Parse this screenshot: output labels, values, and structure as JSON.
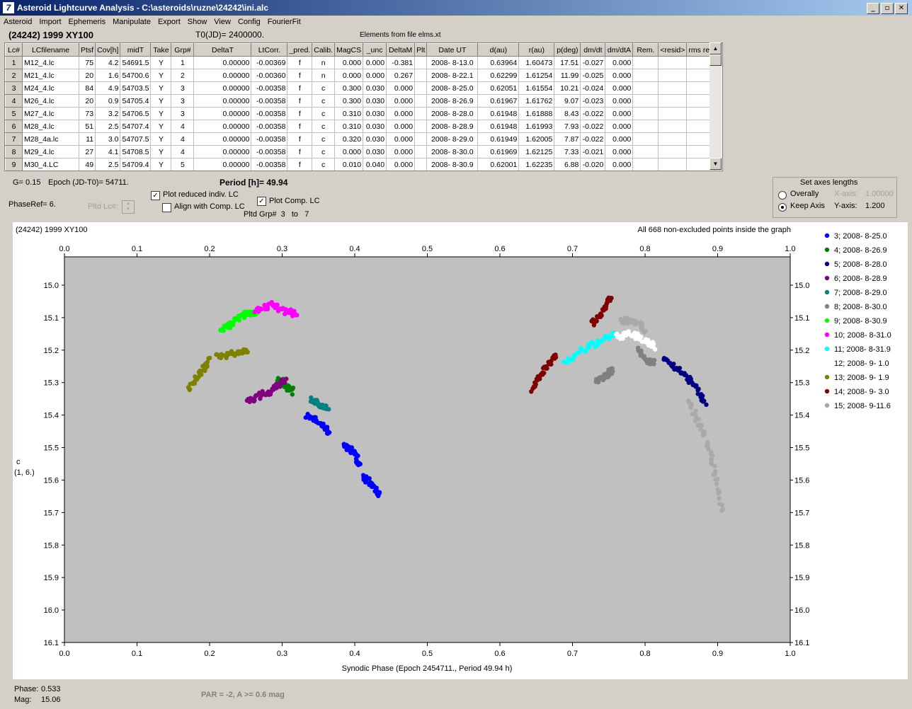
{
  "window": {
    "title": "Asteroid Lightcurve Analysis - C:\\asteroids\\ruzne\\24242\\ini.alc",
    "app_icon_glyph": "7",
    "buttons": {
      "minimize": "_",
      "restore": "▫",
      "close": "✕"
    }
  },
  "menu": [
    "Asteroid",
    "Import",
    "Ephemeris",
    "Manipulate",
    "Export",
    "Show",
    "View",
    "Config",
    "FourierFit"
  ],
  "header": {
    "target": "(24242) 1999 XY100",
    "t0": "T0(JD)= 2400000.",
    "elements": "Elements from file elms.xt"
  },
  "table": {
    "columns": [
      "Lc#",
      "LCfilename",
      "Ptsf",
      "Cov[h]",
      "midT",
      "Take",
      "Grp#",
      "DeltaT",
      "LtCorr.",
      "_pred.",
      "Calib.",
      "MagCS",
      "_unc",
      "DeltaM",
      "Plt",
      "Date UT",
      "d(au)",
      "r(au)",
      "p(deg)",
      "dm/dt",
      "dm/dtA",
      "Rem.",
      "<resid>",
      "rms res"
    ],
    "rows": [
      [
        "1",
        "M12_4.lc",
        "75",
        "4.2",
        "54691.5",
        "Y",
        "1",
        "0.00000",
        "-0.00369",
        "f",
        "n",
        "0.000",
        "0.000",
        "-0.381",
        "",
        "2008- 8-13.0",
        "0.63964",
        "1.60473",
        "17.51",
        "-0.027",
        "0.000",
        "",
        "",
        ""
      ],
      [
        "2",
        "M21_4.lc",
        "20",
        "1.6",
        "54700.6",
        "Y",
        "2",
        "0.00000",
        "-0.00360",
        "f",
        "n",
        "0.000",
        "0.000",
        "0.267",
        "",
        "2008- 8-22.1",
        "0.62299",
        "1.61254",
        "11.99",
        "-0.025",
        "0.000",
        "",
        "",
        ""
      ],
      [
        "3",
        "M24_4.lc",
        "84",
        "4.9",
        "54703.5",
        "Y",
        "3",
        "0.00000",
        "-0.00358",
        "f",
        "c",
        "0.300",
        "0.030",
        "0.000",
        "",
        "2008- 8-25.0",
        "0.62051",
        "1.61554",
        "10.21",
        "-0.024",
        "0.000",
        "",
        "",
        ""
      ],
      [
        "4",
        "M26_4.lc",
        "20",
        "0.9",
        "54705.4",
        "Y",
        "3",
        "0.00000",
        "-0.00358",
        "f",
        "c",
        "0.300",
        "0.030",
        "0.000",
        "",
        "2008- 8-26.9",
        "0.61967",
        "1.61762",
        "9.07",
        "-0.023",
        "0.000",
        "",
        "",
        ""
      ],
      [
        "5",
        "M27_4.lc",
        "73",
        "3.2",
        "54706.5",
        "Y",
        "3",
        "0.00000",
        "-0.00358",
        "f",
        "c",
        "0.310",
        "0.030",
        "0.000",
        "",
        "2008- 8-28.0",
        "0.61948",
        "1.61888",
        "8.43",
        "-0.022",
        "0.000",
        "",
        "",
        ""
      ],
      [
        "6",
        "M28_4.lc",
        "51",
        "2.5",
        "54707.4",
        "Y",
        "4",
        "0.00000",
        "-0.00358",
        "f",
        "c",
        "0.310",
        "0.030",
        "0.000",
        "",
        "2008- 8-28.9",
        "0.61948",
        "1.61993",
        "7.93",
        "-0.022",
        "0.000",
        "",
        "",
        ""
      ],
      [
        "7",
        "M28_4a.lc",
        "11",
        "3.0",
        "54707.5",
        "Y",
        "4",
        "0.00000",
        "-0.00358",
        "f",
        "c",
        "0.320",
        "0.030",
        "0.000",
        "",
        "2008- 8-29.0",
        "0.61949",
        "1.62005",
        "7.87",
        "-0.022",
        "0.000",
        "",
        "",
        ""
      ],
      [
        "8",
        "M29_4.lc",
        "27",
        "4.1",
        "54708.5",
        "Y",
        "4",
        "0.00000",
        "-0.00358",
        "f",
        "c",
        "0.000",
        "0.030",
        "0.000",
        "",
        "2008- 8-30.0",
        "0.61969",
        "1.62125",
        "7.33",
        "-0.021",
        "0.000",
        "",
        "",
        ""
      ],
      [
        "9",
        "M30_4.LC",
        "49",
        "2.5",
        "54709.4",
        "Y",
        "5",
        "0.00000",
        "-0.00358",
        "f",
        "c",
        "0.010",
        "0.040",
        "0.000",
        "",
        "2008- 8-30.9",
        "0.62001",
        "1.62235",
        "6.88",
        "-0.020",
        "0.000",
        "",
        "",
        ""
      ]
    ]
  },
  "controls": {
    "g": "G= 0.15",
    "epoch": "Epoch (JD-T0)= 54711.",
    "period": "Period [h]= 49.94",
    "phase_ref": "PhaseRef= 6.",
    "pltd_lc": "Pltd Lc#:",
    "plot_reduced": "Plot reduced indiv. LC",
    "plot_reduced_checked": true,
    "align_comp": "Align with Comp. LC",
    "align_comp_checked": false,
    "plot_comp": "Plot Comp. LC",
    "plot_comp_checked": true,
    "pltd_grp": "Pltd Grp#  3   to   7"
  },
  "axes_box": {
    "title": "Set axes lengths",
    "overally": "Overally",
    "keep_axis": "Keep Axis",
    "x_label": "X-axis:",
    "x_value": "1.00000",
    "y_label": "Y-axis:",
    "y_value": "1.200",
    "selected": "keep_axis"
  },
  "chart_data": {
    "type": "scatter",
    "title": "(24242) 1999 XY100",
    "annotation": "All 668 non-excluded points inside the graph",
    "xlabel": "Synodic Phase (Epoch 2454711., Period 49.94 h)",
    "ylabel_lines": [
      "c",
      "(1, 6.)"
    ],
    "xlim": [
      0.0,
      1.0
    ],
    "ylim": [
      16.1,
      14.9
    ],
    "y_inverted": true,
    "x_ticks": [
      "0.0",
      "0.1",
      "0.2",
      "0.3",
      "0.4",
      "0.5",
      "0.6",
      "0.7",
      "0.8",
      "0.9",
      "1.0"
    ],
    "y_ticks": [
      "15.0",
      "15.1",
      "15.2",
      "15.3",
      "15.4",
      "15.5",
      "15.6",
      "15.7",
      "15.8",
      "15.9",
      "16.0",
      "16.1"
    ],
    "legend_position": "right",
    "series": [
      {
        "name": "3; 2008- 8-25.0",
        "color": "#0000ff",
        "segments": [
          [
            [
              0.335,
              15.4
            ],
            [
              0.355,
              15.43
            ],
            [
              0.365,
              15.46
            ]
          ],
          [
            [
              0.383,
              15.49
            ],
            [
              0.397,
              15.51
            ],
            [
              0.408,
              15.55
            ]
          ],
          [
            [
              0.413,
              15.59
            ],
            [
              0.425,
              15.62
            ],
            [
              0.434,
              15.65
            ]
          ]
        ]
      },
      {
        "name": "4; 2008- 8-26.9",
        "color": "#008000",
        "segments": [
          [
            [
              0.295,
              15.29
            ],
            [
              0.305,
              15.31
            ],
            [
              0.316,
              15.33
            ]
          ]
        ]
      },
      {
        "name": "5; 2008- 8-28.0",
        "color": "#000080",
        "segments": [
          [
            [
              0.825,
              15.22
            ],
            [
              0.845,
              15.26
            ],
            [
              0.865,
              15.3
            ],
            [
              0.885,
              15.37
            ]
          ]
        ]
      },
      {
        "name": "6; 2008- 8-28.9",
        "color": "#800080",
        "segments": [
          [
            [
              0.25,
              15.36
            ],
            [
              0.27,
              15.34
            ],
            [
              0.29,
              15.32
            ],
            [
              0.305,
              15.29
            ]
          ]
        ]
      },
      {
        "name": "7; 2008- 8-29.0",
        "color": "#008080",
        "segments": [
          [
            [
              0.34,
              15.35
            ],
            [
              0.352,
              15.37
            ],
            [
              0.363,
              15.38
            ]
          ]
        ]
      },
      {
        "name": "8; 2008- 8-30.0",
        "color": "#808080",
        "segments": [
          [
            [
              0.733,
              15.3
            ],
            [
              0.745,
              15.28
            ],
            [
              0.755,
              15.26
            ]
          ],
          [
            [
              0.79,
              15.2
            ],
            [
              0.802,
              15.23
            ],
            [
              0.812,
              15.24
            ]
          ]
        ]
      },
      {
        "name": "9; 2008- 8-30.9",
        "color": "#00ff00",
        "segments": [
          [
            [
              0.215,
              15.14
            ],
            [
              0.235,
              15.11
            ],
            [
              0.25,
              15.09
            ],
            [
              0.265,
              15.08
            ]
          ]
        ]
      },
      {
        "name": "10; 2008- 8-31.0",
        "color": "#ff00ff",
        "segments": [
          [
            [
              0.262,
              15.08
            ],
            [
              0.285,
              15.06
            ],
            [
              0.305,
              15.08
            ],
            [
              0.32,
              15.09
            ]
          ]
        ]
      },
      {
        "name": "11; 2008- 8-31.9",
        "color": "#00ffff",
        "segments": [
          [
            [
              0.688,
              15.24
            ],
            [
              0.715,
              15.2
            ],
            [
              0.74,
              15.17
            ],
            [
              0.76,
              15.15
            ]
          ]
        ]
      },
      {
        "name": "12; 2008- 9- 1.0",
        "color": "#ffffff",
        "segments": [
          [
            [
              0.758,
              15.16
            ],
            [
              0.78,
              15.15
            ],
            [
              0.8,
              15.17
            ],
            [
              0.815,
              15.19
            ]
          ]
        ]
      },
      {
        "name": "13; 2008- 9- 1.9",
        "color": "#808000",
        "segments": [
          [
            [
              0.172,
              15.32
            ],
            [
              0.19,
              15.26
            ],
            [
              0.2,
              15.23
            ]
          ],
          [
            [
              0.21,
              15.22
            ],
            [
              0.235,
              15.21
            ],
            [
              0.255,
              15.2
            ]
          ]
        ]
      },
      {
        "name": "14; 2008- 9- 3.0",
        "color": "#800000",
        "segments": [
          [
            [
              0.645,
              15.32
            ],
            [
              0.66,
              15.26
            ],
            [
              0.678,
              15.21
            ]
          ],
          [
            [
              0.728,
              15.12
            ],
            [
              0.742,
              15.08
            ],
            [
              0.752,
              15.03
            ]
          ]
        ]
      },
      {
        "name": "15; 2008- 9-11.6",
        "color": "#a9a9a9",
        "segments": [
          [
            [
              0.768,
              15.11
            ],
            [
              0.785,
              15.11
            ],
            [
              0.802,
              15.14
            ]
          ],
          [
            [
              0.86,
              15.36
            ],
            [
              0.88,
              15.45
            ],
            [
              0.895,
              15.56
            ],
            [
              0.908,
              15.71
            ]
          ]
        ]
      }
    ]
  },
  "status": {
    "phase_label": "Phase:",
    "phase_value": "0.533",
    "mag_label": "Mag:",
    "mag_value": "15.06",
    "par": "PAR = -2, A >= 0.6 mag"
  }
}
